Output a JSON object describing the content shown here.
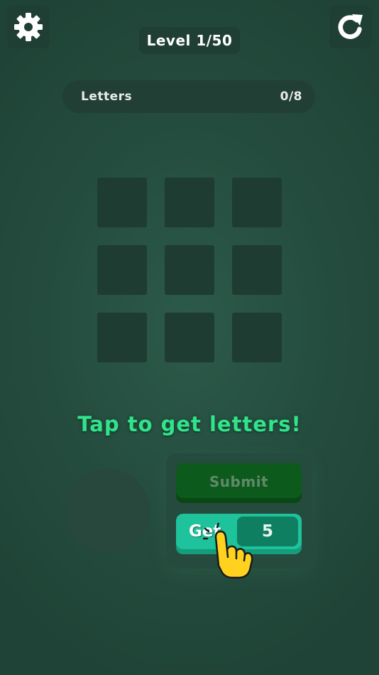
{
  "header": {
    "level_label": "Level 1/50",
    "settings_icon": "gear-icon",
    "restart_icon": "restart-icon"
  },
  "letters": {
    "label": "Letters",
    "count": "0/8"
  },
  "grid": {
    "rows": 3,
    "cols": 3
  },
  "hint": "Tap to get letters!",
  "actions": {
    "submit_label": "Submit",
    "get_label": "Get",
    "get_count": "5"
  },
  "colors": {
    "background": "#244c3e",
    "hint_text": "#31e38a",
    "submit_bg": "#0c5a1c",
    "get_bg": "#1ec29b",
    "pointer_hand": "#ffd21f"
  },
  "icons": {
    "tutorial_pointer": "pointing-hand-icon"
  }
}
